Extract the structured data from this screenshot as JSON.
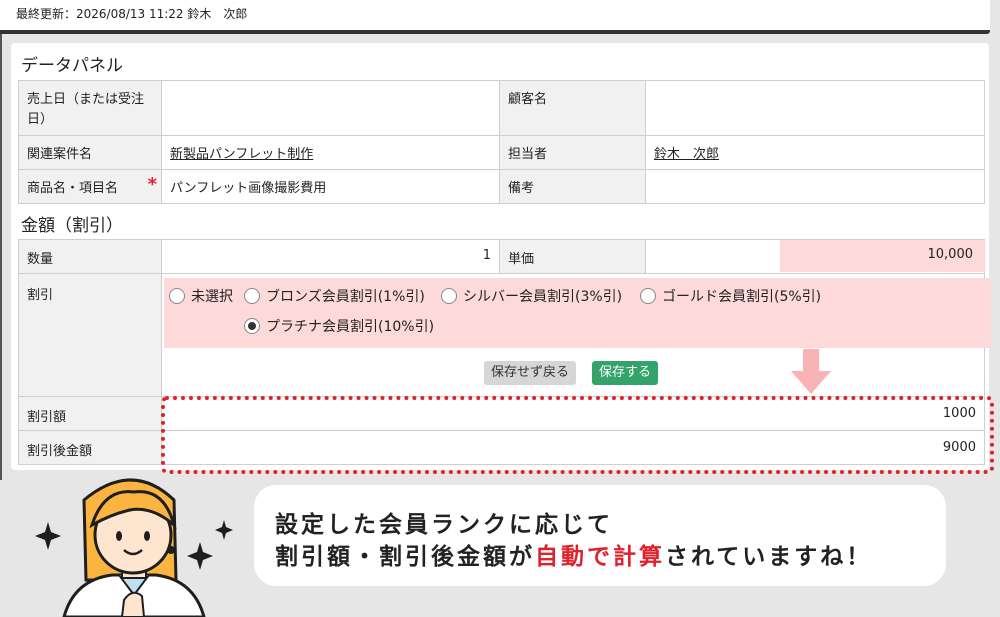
{
  "header": {
    "updated": "最終更新：2026/08/13 11:22 鈴木　次郎"
  },
  "data_panel": {
    "title": "データパネル",
    "rows": [
      {
        "label1": "売上日（または受注日）",
        "value1": "",
        "label2": "顧客名",
        "value2": ""
      },
      {
        "label1": "関連案件名",
        "value1": "新製品パンフレット制作",
        "label2": "担当者",
        "value2": "鈴木　次郎"
      },
      {
        "label1": "商品名・項目名",
        "required": "*",
        "value1": "パンフレット画像撮影費用",
        "label2": "備考",
        "value2": ""
      }
    ]
  },
  "amount_panel": {
    "title": "金額（割引）",
    "quantity_label": "数量",
    "quantity_value": "1",
    "unit_price_label": "単価",
    "unit_price_value": "10,000",
    "discount_label": "割引",
    "discount_options": [
      {
        "label": "未選択",
        "selected": false
      },
      {
        "label": "ブロンズ会員割引(1%引)",
        "selected": false
      },
      {
        "label": "シルバー会員割引(3%引)",
        "selected": false
      },
      {
        "label": "ゴールド会員割引(5%引)",
        "selected": false
      },
      {
        "label": "プラチナ会員割引(10%引)",
        "selected": true
      }
    ],
    "back_button": "保存せず戻る",
    "save_button": "保存する",
    "discount_amount_label": "割引額",
    "discount_amount_value": "1000",
    "after_discount_label": "割引後金額",
    "after_discount_value": "9000"
  },
  "callout": {
    "line1": "設定した会員ランクに応じて",
    "line2_a": "割引額・割引後金額が",
    "line2_hl": "自動で計算",
    "line2_b": "されていますね！"
  },
  "colors": {
    "highlight": "#fdd9d9",
    "accent_red": "#e0202a",
    "save_green": "#34a36b"
  }
}
